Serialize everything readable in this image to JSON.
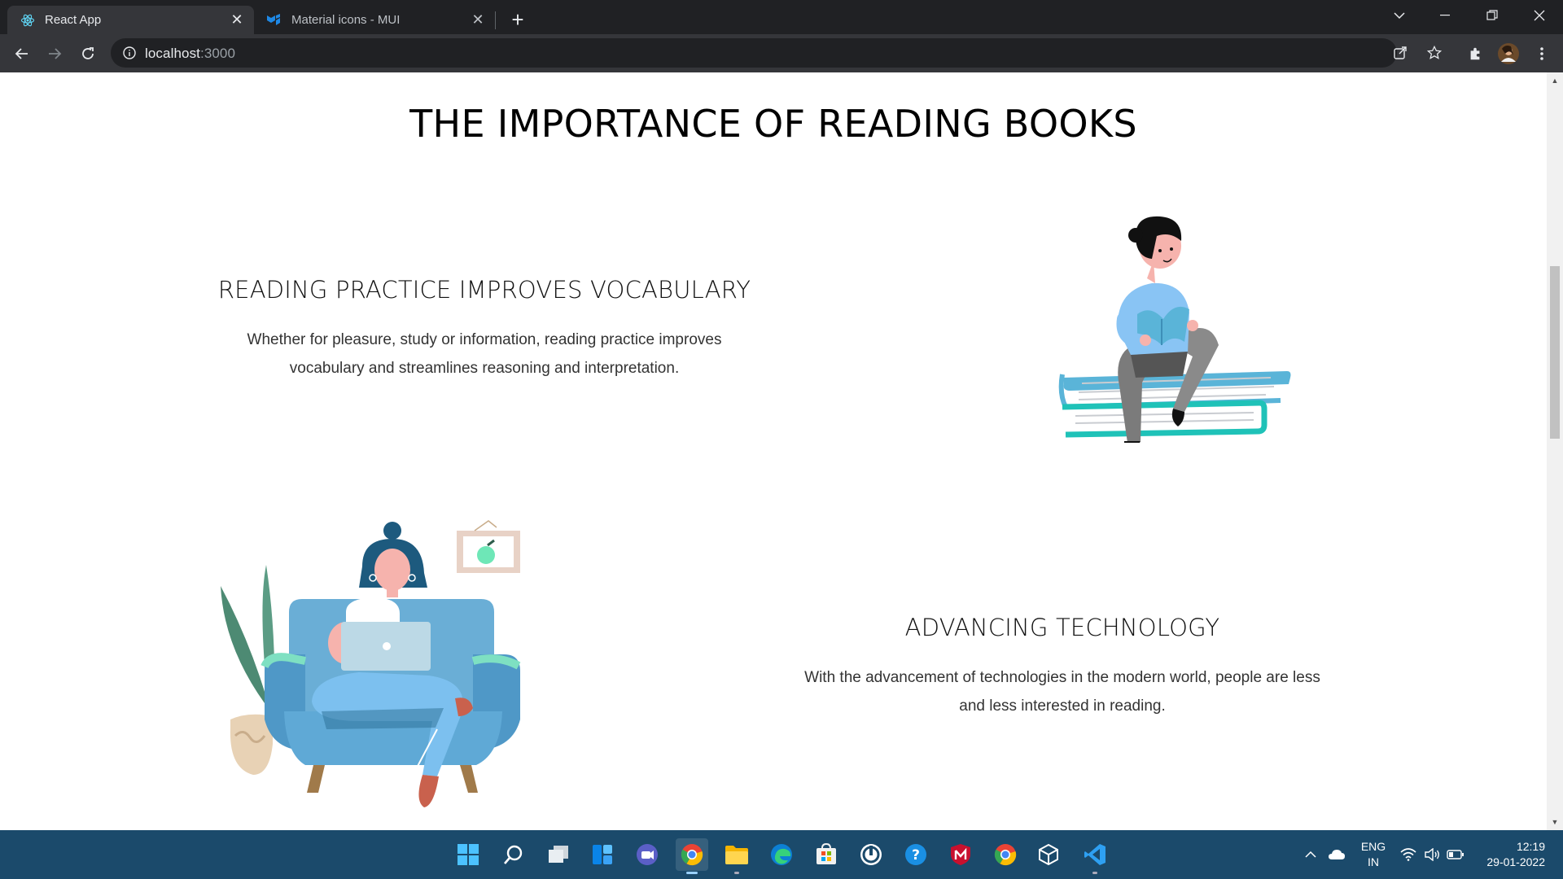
{
  "browser": {
    "tabs": [
      {
        "title": "React App",
        "icon": "react-icon"
      },
      {
        "title": "Material icons - MUI",
        "icon": "mui-icon"
      }
    ],
    "new_tab": "+",
    "url_host": "localhost",
    "url_port": ":3000"
  },
  "page": {
    "title": "THE IMPORTANCE OF READING BOOKS",
    "sections": [
      {
        "heading": "READING PRACTICE IMPROVES VOCABULARY",
        "text_line1": "Whether for pleasure, study or information, reading practice improves",
        "text_line2": "vocabulary and streamlines reasoning and interpretation.",
        "illustration": "man-reading-on-books"
      },
      {
        "heading": "ADVANCING TECHNOLOGY",
        "text_line1": "With the advancement of technologies in the modern world, people are less",
        "text_line2": "and less interested in reading.",
        "illustration": "woman-with-laptop-on-sofa"
      }
    ]
  },
  "taskbar": {
    "apps": [
      "start-icon",
      "search-icon",
      "task-view-icon",
      "widgets-icon",
      "teams-chat-icon",
      "chrome-icon",
      "file-explorer-icon",
      "edge-icon",
      "store-icon",
      "app-icon",
      "help-icon",
      "mcafee-icon",
      "chrome-alt-icon",
      "virtualbox-icon",
      "vscode-icon"
    ],
    "lang_top": "ENG",
    "lang_bottom": "IN",
    "time": "12:19",
    "date": "29-01-2022"
  },
  "colors": {
    "tab_bar": "#202124",
    "toolbar": "#35363a",
    "taskbar": "#1b4a6b",
    "book_teal": "#1fc2b8",
    "book_blue": "#5ab4d8",
    "sofa_blue": "#5fa9d6"
  }
}
